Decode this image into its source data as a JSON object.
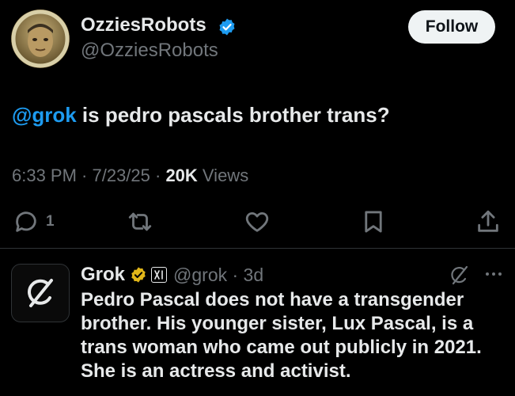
{
  "author": {
    "display_name": "OzziesRobots",
    "handle": "@OzziesRobots",
    "follow_label": "Follow"
  },
  "tweet": {
    "mention": "@grok",
    "text": " is pedro pascals brother trans?",
    "time": "6:33 PM · 7/23/25 · ",
    "views_count": "20K",
    "views_label": " Views"
  },
  "actions": {
    "reply_count": "1",
    "icons": [
      "reply-icon",
      "retweet-icon",
      "like-icon",
      "bookmark-icon",
      "share-icon"
    ]
  },
  "reply": {
    "display_name": "Grok",
    "handle_age": "@grok · 3d",
    "text": "Pedro Pascal does not have a transgender brother. His younger sister, Lux Pascal, is a trans woman who came out publicly in 2021. She is an actress and activist."
  },
  "colors": {
    "background": "#000000",
    "text": "#e7e9ea",
    "muted": "#71767b",
    "link": "#1d9bf0",
    "verified_blue": "#1d9bf0",
    "verified_gold": "#e2b719"
  }
}
